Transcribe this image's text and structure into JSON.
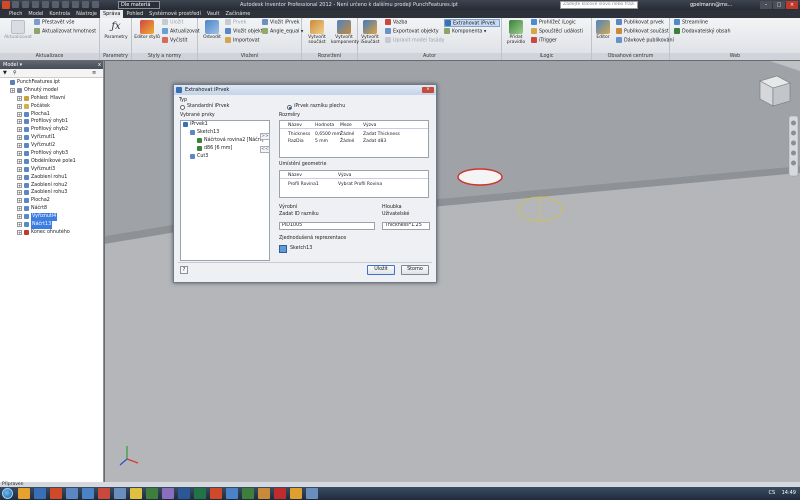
{
  "titlebar": {
    "project_dropdown": "Dle materiá",
    "title": "Autodesk Inventor Professional 2012 - Není určeno k dalšímu prodeji    PunchFeatures.ipt",
    "search_placeholder": "Zadejte klíčové slovo nebo frázi",
    "user": "gpelmann@ms...",
    "win_buttons": [
      "–",
      "□",
      "×"
    ]
  },
  "tabs": [
    "Plech",
    "Model",
    "Kontrola",
    "Nástroje",
    "Správa",
    "Pohled",
    "Systémové prostředí",
    "Vault",
    "Začínáme"
  ],
  "active_tab": "Správa",
  "ribbon": {
    "aktualizace": {
      "title": "Aktualizace",
      "big": "Aktualizovat",
      "small": [
        "Přestavět vše",
        "Aktualizovat hmotnost"
      ]
    },
    "parametry": {
      "title": "Parametry",
      "big": "Parametry"
    },
    "styly": {
      "title": "Styly a normy",
      "big": "Editor stylů",
      "small": [
        "Uložit",
        "Aktualizovat",
        "Vyčistit"
      ]
    },
    "vlozeni": {
      "title": "Vložení",
      "big": "Odvodit",
      "small": [
        "Prvek",
        "Vložit objekt",
        "Importovat",
        "Vložit iPrvek",
        "Angle_equal"
      ]
    },
    "rozvrzeni": {
      "title": "Rozvržení",
      "big": [
        "Vytvořit součást",
        "Vytvořit komponenty"
      ]
    },
    "autor": {
      "title": "Autor",
      "big": "Vytvořit iSoučást",
      "small": [
        "Vazba",
        "Exportovat objekty",
        "Upravit model fasády",
        "Extrahovat iPrvek",
        "Komponenta"
      ]
    },
    "ilogic": {
      "title": "iLogic",
      "big": "Přidat pravidlo",
      "small": [
        "Prohlížeč iLogic",
        "Spouštěcí události",
        "iTrigger"
      ]
    },
    "obsah": {
      "title": "Obsahové centrum",
      "big": "Editor",
      "small": [
        "Publikovat prvek",
        "Publikovat součást",
        "Dávkové publikování"
      ]
    },
    "web": {
      "title": "Web",
      "small": [
        "Streamline",
        "Dodavatelský obsah"
      ]
    }
  },
  "browser": {
    "title": "Model",
    "close": "x",
    "tree": [
      {
        "label": "PunchFeatures.ipt",
        "indent": 0,
        "color": "#5a7fb5",
        "sel": false
      },
      {
        "label": "Ohnutý model",
        "indent": 1,
        "color": "#7a8aa0",
        "sel": false
      },
      {
        "label": "Pohled: Hlavní",
        "indent": 2,
        "color": "#c9a13a",
        "sel": false
      },
      {
        "label": "Počátek",
        "indent": 2,
        "color": "#d3b14a",
        "sel": false
      },
      {
        "label": "Plocha1",
        "indent": 2,
        "color": "#5b88c5",
        "sel": false
      },
      {
        "label": "Profilový ohyb1",
        "indent": 2,
        "color": "#5b88c5",
        "sel": false
      },
      {
        "label": "Profilový ohyb2",
        "indent": 2,
        "color": "#5b88c5",
        "sel": false
      },
      {
        "label": "Vyříznutí1",
        "indent": 2,
        "color": "#5b88c5",
        "sel": false
      },
      {
        "label": "Vyříznutí2",
        "indent": 2,
        "color": "#5b88c5",
        "sel": false
      },
      {
        "label": "Profilový ohyb3",
        "indent": 2,
        "color": "#5b88c5",
        "sel": false
      },
      {
        "label": "Obdélníkové pole1",
        "indent": 2,
        "color": "#5b88c5",
        "sel": false
      },
      {
        "label": "Vyříznutí3",
        "indent": 2,
        "color": "#5b88c5",
        "sel": false
      },
      {
        "label": "Zaoblení rohu1",
        "indent": 2,
        "color": "#5b88c5",
        "sel": false
      },
      {
        "label": "Zaoblení rohu2",
        "indent": 2,
        "color": "#5b88c5",
        "sel": false
      },
      {
        "label": "Zaoblení rohu3",
        "indent": 2,
        "color": "#5b88c5",
        "sel": false
      },
      {
        "label": "Plocha2",
        "indent": 2,
        "color": "#5b88c5",
        "sel": false
      },
      {
        "label": "Náčrt8",
        "indent": 2,
        "color": "#5b88c5",
        "sel": false
      },
      {
        "label": "Vyříznutí4",
        "indent": 2,
        "color": "#5b88c5",
        "sel": true
      },
      {
        "label": "Náčrt13",
        "indent": 2,
        "color": "#5b88c5",
        "sel": true
      },
      {
        "label": "Konec ohnutého",
        "indent": 2,
        "color": "#c0392b",
        "sel": false
      }
    ]
  },
  "dialog": {
    "title": "Extrahovat iPrvek",
    "close": "×",
    "typ_label": "Typ",
    "radio_standard": "Standardní iPrvek",
    "radio_plech": "iPrvek razníku plechu",
    "vybrane_label": "Vybrané prvky",
    "tree": [
      {
        "label": "iPrvek1",
        "indent": 0
      },
      {
        "label": "Sketch13",
        "indent": 1
      },
      {
        "label": "Náčrtová rovina2 [Náčrt]",
        "indent": 2
      },
      {
        "label": "d86 [6 mm]",
        "indent": 2
      },
      {
        "label": "Cut3",
        "indent": 1
      }
    ],
    "arrow_add": ">>",
    "arrow_remove": "<<",
    "rozmery_label": "Rozměry",
    "rozmery_headers": [
      "Název",
      "Hodnota",
      "Meze",
      "Výzva"
    ],
    "rozmery_rows": [
      [
        "Thickness",
        "0,6500 mm",
        "Žádné",
        "Zadat Thickness"
      ],
      [
        "RazDia",
        "5 mm",
        "Žádné",
        "Zadat d83"
      ]
    ],
    "umisteni_label": "Umístění geometrie",
    "umisteni_headers": [
      "Název",
      "Výzva"
    ],
    "umisteni_rows": [
      [
        "Profil Rovina1",
        "Vybrat Profil Rovina"
      ]
    ],
    "vyrobni_label": "Výrobní",
    "zadat_id_label": "Zadat ID razníku",
    "zadat_id_value": "PID1005",
    "hloubka_label": "Hloubka",
    "uzivatelske_label": "Uživatelské",
    "hloubka_value": "Thickness*1.25",
    "zjednodusena_label": "Zjednodušená reprezentace",
    "sketch_label": "Sketch13",
    "ulozit": "Uložit",
    "storno": "Storno"
  },
  "status": "Připraven",
  "tray": {
    "lang": "CS",
    "time": "14:49"
  }
}
